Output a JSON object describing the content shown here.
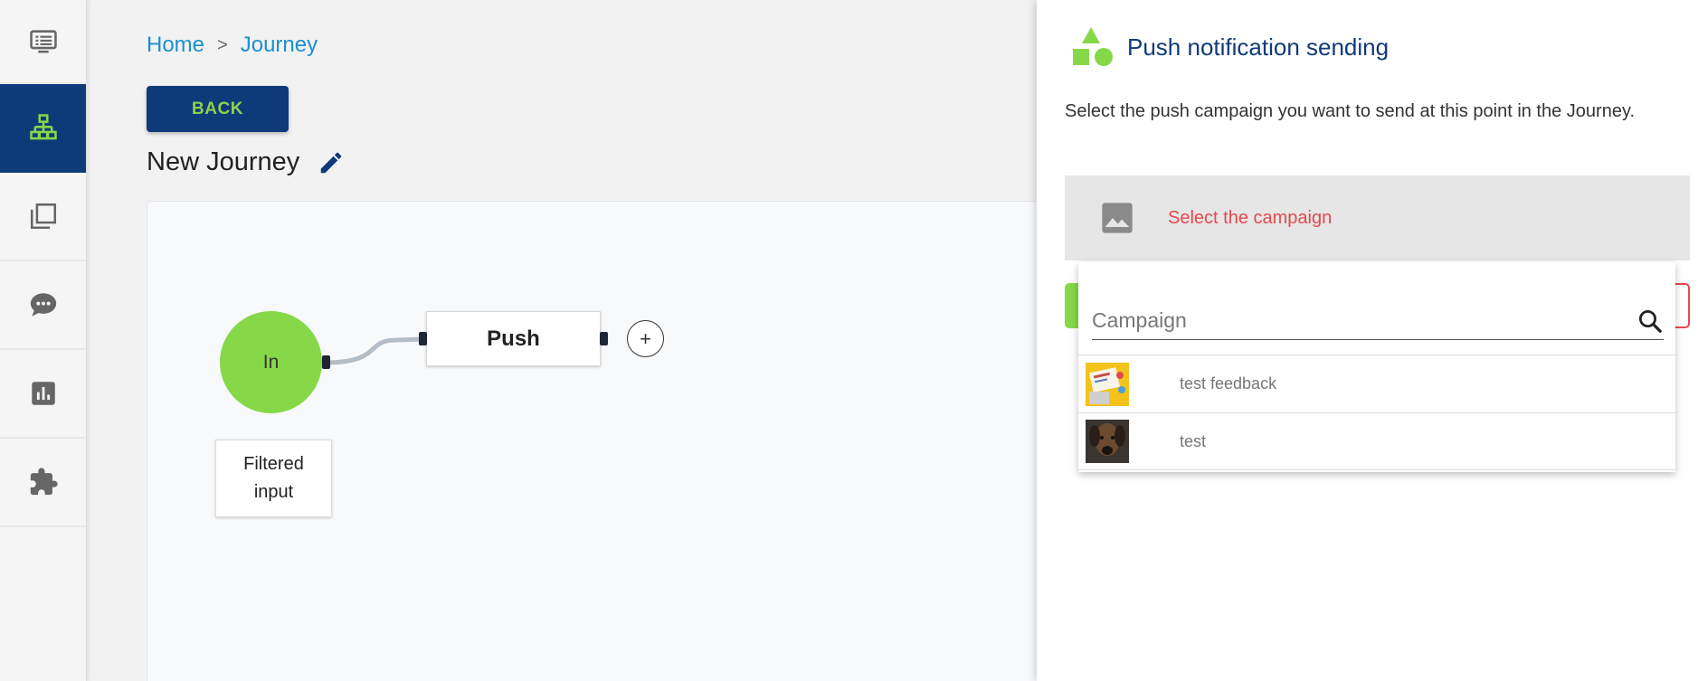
{
  "sidebar": {
    "items": [
      {
        "icon": "list-icon"
      },
      {
        "icon": "sitemap-icon"
      },
      {
        "icon": "copy-icon"
      },
      {
        "icon": "chat-icon"
      },
      {
        "icon": "bar-chart-icon"
      },
      {
        "icon": "puzzle-icon"
      }
    ],
    "active_index": 1
  },
  "breadcrumb": {
    "home": "Home",
    "separator": ">",
    "current": "Journey"
  },
  "back_button": "BACK",
  "page_title": "New Journey",
  "canvas": {
    "in_node": "In",
    "push_node": "Push",
    "add_symbol": "+",
    "filtered_label": "Filtered input"
  },
  "panel": {
    "title": "Push notification sending",
    "description": "Select the push campaign you want to send at this point in the Journey.",
    "select_label": "Select the campaign",
    "search_placeholder": "Campaign",
    "options": [
      {
        "label": "test feedback"
      },
      {
        "label": "test"
      }
    ]
  },
  "colors": {
    "primary": "#0f3a7a",
    "accent": "#86d848",
    "link": "#1b8fd1",
    "error": "#e5484d"
  }
}
